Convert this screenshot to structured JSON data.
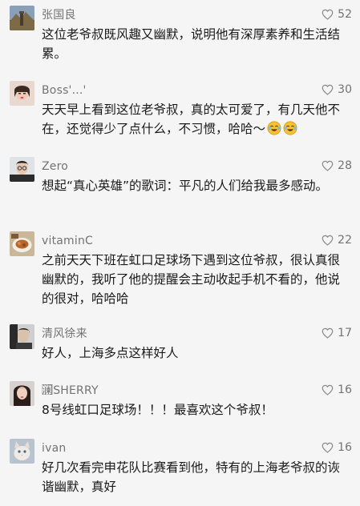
{
  "comments": [
    {
      "name": "张国良",
      "likes": "52",
      "text": "这位老爷叔既风趣又幽默，说明他有深厚素养和生活结累。",
      "avatar": "mountain-landscape"
    },
    {
      "name": "Boss'...'",
      "likes": "30",
      "text": "天天早上看到这位老爷叔，真的太可爱了，有几天他不在，还觉得少了点什么，不习惯，哈哈～",
      "avatar": "portrait-girl",
      "emojis": [
        "laugh-cry-emoji",
        "laugh-cry-emoji"
      ]
    },
    {
      "name": "Zero",
      "likes": "28",
      "text": "想起“真心英雄”的歌词：平凡的人们给我最多感动。",
      "avatar": "portrait-man-glasses"
    },
    {
      "name": "vitaminC",
      "likes": "22",
      "text": "之前天天下班在虹口足球场下遇到这位爷叔，很认真很幽默的，我听了他的提醒会主动收起手机不看的，他说的很对，哈哈哈",
      "avatar": "food-photo"
    },
    {
      "name": "清风徐来",
      "likes": "17",
      "text": "好人，上海多点这样好人",
      "avatar": "portrait-man-dark"
    },
    {
      "name": "澜⃞SHERRY",
      "likes": "16",
      "text": "8号线虹口足球场！！！最喜欢这个爷叔！",
      "avatar": "portrait-girl-dark"
    },
    {
      "name": "ivan",
      "likes": "16",
      "text": "好几次看完申花队比赛看到他，特有的上海老爷叔的诙谐幽默，真好",
      "avatar": "cat-photo"
    }
  ],
  "colors": {
    "background": "#f5f5f5",
    "name": "#737373",
    "text": "#1a1a1a",
    "like_icon": "#8a8a8a"
  },
  "icons": {
    "like": "heart-outline-icon"
  }
}
